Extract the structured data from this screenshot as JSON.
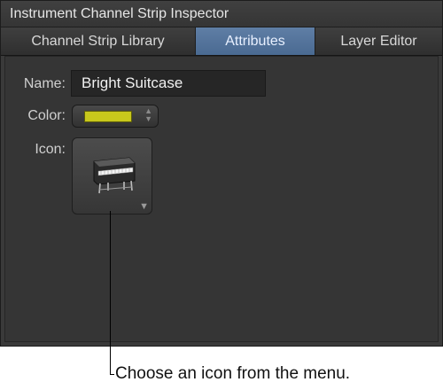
{
  "window": {
    "title": "Instrument Channel Strip Inspector"
  },
  "tabs": [
    {
      "label": "Channel Strip Library",
      "active": false
    },
    {
      "label": "Attributes",
      "active": true
    },
    {
      "label": "Layer Editor",
      "active": false
    }
  ],
  "attributes": {
    "name_label": "Name:",
    "name_value": "Bright Suitcase",
    "color_label": "Color:",
    "color_value": "#c8c81c",
    "icon_label": "Icon:",
    "icon_name": "electric-piano-icon"
  },
  "callout": {
    "text": "Choose an icon from the menu."
  }
}
